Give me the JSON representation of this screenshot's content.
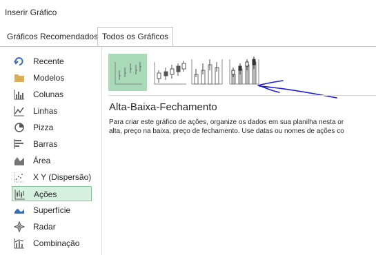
{
  "window": {
    "title": "Inserir Gráfico"
  },
  "tabs": [
    {
      "label": "Gráficos Recomendados"
    },
    {
      "label": "Todos os Gráficos"
    }
  ],
  "sidebar": {
    "items": [
      {
        "label": "Recente",
        "icon": "recent-icon"
      },
      {
        "label": "Modelos",
        "icon": "folder-icon"
      },
      {
        "label": "Colunas",
        "icon": "column-chart-icon"
      },
      {
        "label": "Linhas",
        "icon": "line-chart-icon"
      },
      {
        "label": "Pizza",
        "icon": "pie-chart-icon"
      },
      {
        "label": "Barras",
        "icon": "bar-chart-icon"
      },
      {
        "label": "Área",
        "icon": "area-chart-icon"
      },
      {
        "label": "X Y (Dispersão)",
        "icon": "scatter-chart-icon"
      },
      {
        "label": "Ações",
        "icon": "stock-chart-icon"
      },
      {
        "label": "Superfície",
        "icon": "surface-chart-icon"
      },
      {
        "label": "Radar",
        "icon": "radar-chart-icon"
      },
      {
        "label": "Combinação",
        "icon": "combo-chart-icon"
      }
    ],
    "selected": "Ações"
  },
  "main": {
    "subtypes": [
      {
        "icon": "high-low-close-icon",
        "selected": true
      },
      {
        "icon": "open-high-low-close-icon",
        "selected": false
      },
      {
        "icon": "volume-high-low-close-icon",
        "selected": false
      },
      {
        "icon": "volume-open-high-low-close-icon",
        "selected": false
      }
    ],
    "chart_title": "Alta-Baixa-Fechamento",
    "description_line1": "Para criar este gráfico de ações, organize os dados em sua planilha nesta or",
    "description_line2": "alta, preço na baixa, preço de fechamento. Use datas ou nomes de ações co"
  },
  "colors": {
    "selected_fill": "#a8dab8",
    "sidebar_selected": "#d6f0df",
    "annotation": "#1a1adb"
  }
}
